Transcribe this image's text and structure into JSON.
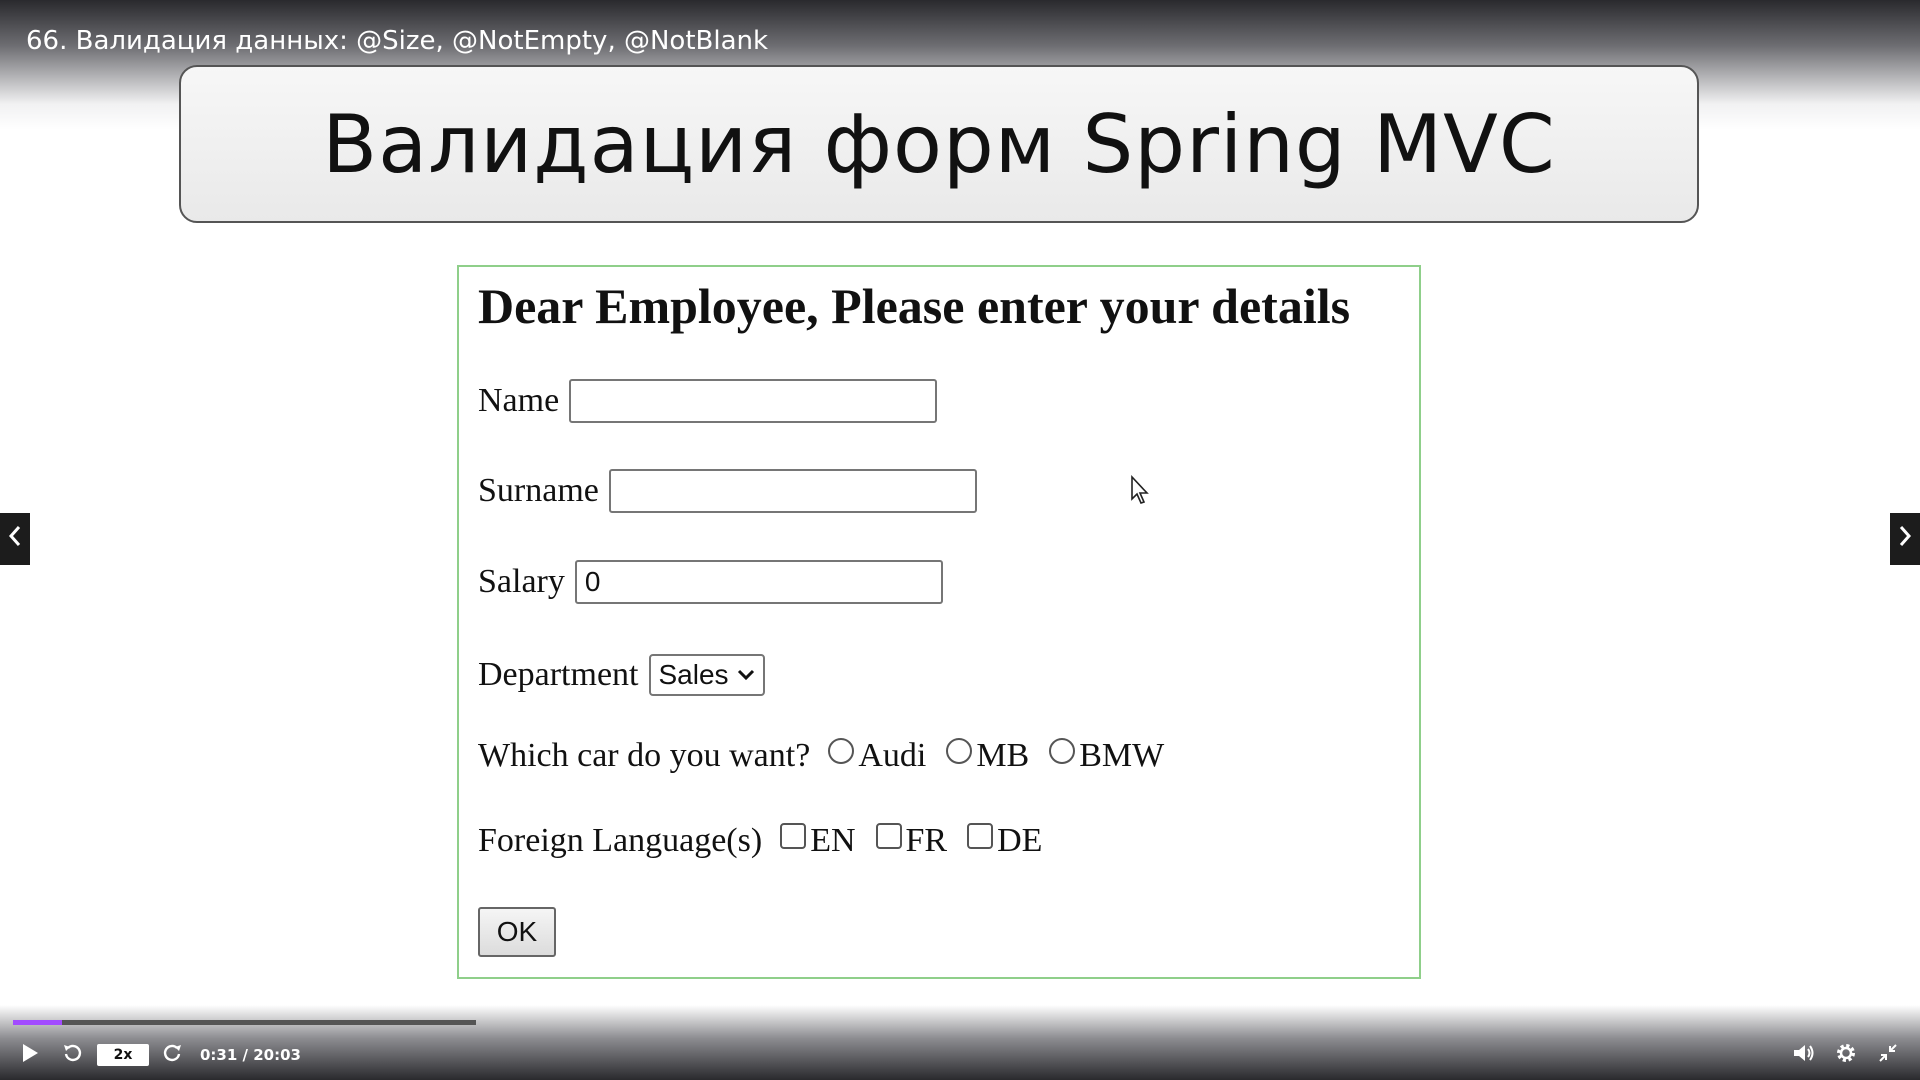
{
  "video": {
    "title": "66. Валидация данных: @Size, @NotEmpty, @NotBlank"
  },
  "slide": {
    "title": "Валидация форм Spring MVC"
  },
  "form": {
    "heading": "Dear Employee, Please enter your details",
    "name_label": "Name",
    "name_value": "",
    "surname_label": "Surname",
    "surname_value": "",
    "salary_label": "Salary",
    "salary_value": "0",
    "department_label": "Department",
    "department_selected": "Sales",
    "car_label": "Which car do you want?",
    "car_options": [
      "Audi",
      "MB",
      "BMW"
    ],
    "language_label": "Foreign Language(s)",
    "language_options": [
      "EN",
      "FR",
      "DE"
    ],
    "ok_label": "OK"
  },
  "player": {
    "speed": "2x",
    "time": "0:31 / 20:03",
    "progress_fraction": 0.026,
    "accent_color": "#a24bff"
  },
  "icons": {
    "play": "play-icon",
    "rewind": "rewind-icon",
    "forward": "forward-icon",
    "volume": "volume-icon",
    "settings": "gear-icon",
    "fullscreen_exit": "fullscreen-exit-icon",
    "prev": "chevron-left-icon",
    "next": "chevron-right-icon",
    "cursor": "mouse-cursor-icon"
  }
}
